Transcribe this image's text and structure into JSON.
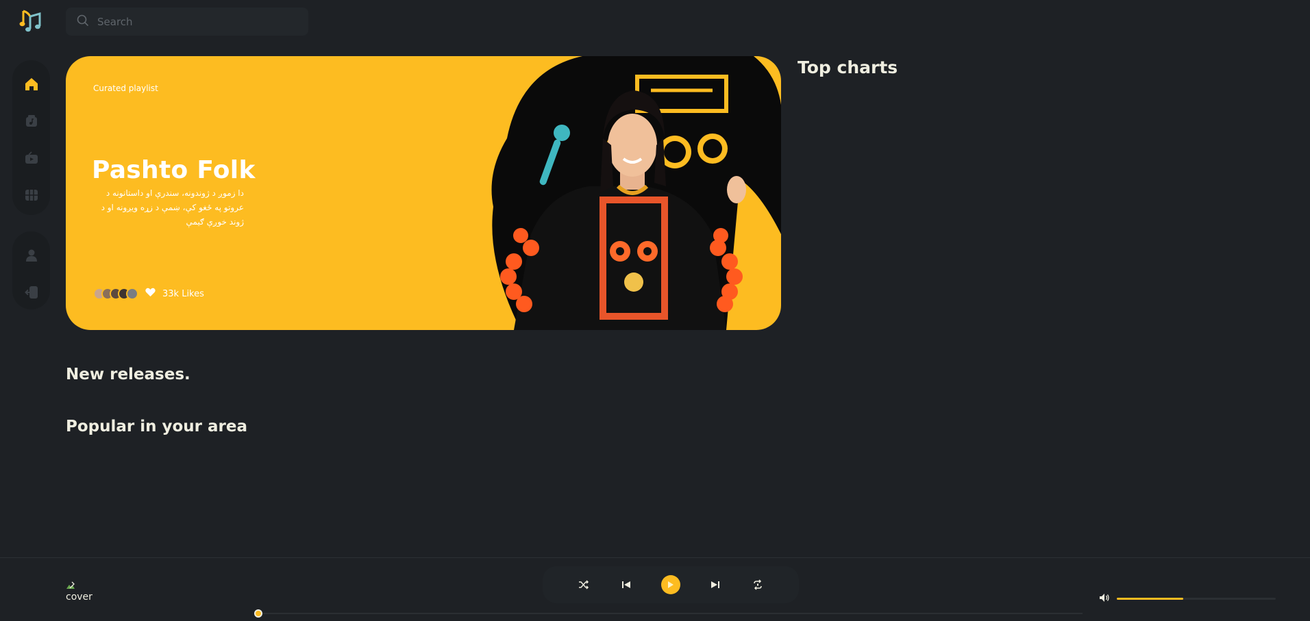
{
  "search": {
    "placeholder": "Search"
  },
  "sidebar": {
    "items": [
      {
        "name": "home",
        "icon": "home-icon",
        "active": true
      },
      {
        "name": "playlists",
        "icon": "music-folder-icon",
        "active": false
      },
      {
        "name": "radio",
        "icon": "radio-icon",
        "active": false
      },
      {
        "name": "videos",
        "icon": "video-grid-icon",
        "active": false
      }
    ],
    "secondary": [
      {
        "name": "profile",
        "icon": "user-icon"
      },
      {
        "name": "logout",
        "icon": "logout-icon"
      }
    ]
  },
  "hero": {
    "tag": "Curated playlist",
    "title": "Pashto Folk",
    "description": "دا زموږ د ژوندونه، سندرې او داستانونه د عروتو په ځغو کې، ښمې د زړه ویږونه او د ژوند خوږې ګیمې",
    "likes": "33k Likes"
  },
  "sections": {
    "top_charts": "Top charts",
    "new_releases": "New releases.",
    "popular": "Popular in your area"
  },
  "player": {
    "cover_alt": "cover",
    "progress": 0,
    "volume": 0.42
  },
  "colors": {
    "accent": "#fdbc21",
    "background": "#1e2125",
    "sidebar": "#1a1d20",
    "text": "#efeee0"
  }
}
